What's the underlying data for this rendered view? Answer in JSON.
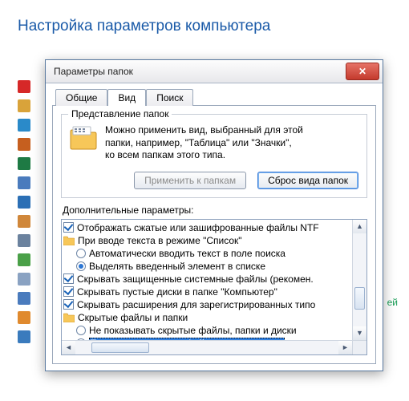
{
  "page": {
    "title": "Настройка параметров компьютера"
  },
  "side_text": "ей",
  "sidebar_icons": [
    {
      "name": "flash-icon",
      "bg": "#d62828"
    },
    {
      "name": "font-icon",
      "bg": "#d9a33a"
    },
    {
      "name": "apps-icon",
      "bg": "#2a8ac9"
    },
    {
      "name": "install-icon",
      "bg": "#c65f1f"
    },
    {
      "name": "monitor-icon",
      "bg": "#1e7a44"
    },
    {
      "name": "drive-icon",
      "bg": "#4a7bbd"
    },
    {
      "name": "lock-icon",
      "bg": "#2b6fb5"
    },
    {
      "name": "chart-icon",
      "bg": "#d0873a"
    },
    {
      "name": "device-icon",
      "bg": "#6b829e"
    },
    {
      "name": "audio-icon",
      "bg": "#4aa048"
    },
    {
      "name": "shield-icon",
      "bg": "#8aa2c2"
    },
    {
      "name": "clock-icon",
      "bg": "#4a7bbd"
    },
    {
      "name": "efax-icon",
      "bg": "#e08a2e"
    },
    {
      "name": "cpu-icon",
      "bg": "#3a7bbd"
    }
  ],
  "dialog": {
    "title": "Параметры папок",
    "close_glyph": "✕",
    "tabs": [
      {
        "id": "general",
        "label": "Общие"
      },
      {
        "id": "view",
        "label": "Вид"
      },
      {
        "id": "search",
        "label": "Поиск"
      }
    ],
    "active_tab": "view",
    "view_tab": {
      "group": {
        "legend": "Представление папок",
        "desc1": "Можно применить вид, выбранный для этой",
        "desc2": "папки, например, \"Таблица\" или \"Значки\",",
        "desc3": "ко всем папкам этого типа.",
        "apply_btn": "Применить к папкам",
        "reset_btn": "Сброс вида папок"
      },
      "adv_label": "Дополнительные параметры:",
      "tree": [
        {
          "type": "checkbox",
          "checked": true,
          "indent": 0,
          "label": "Отображать сжатые или зашифрованные файлы NTF"
        },
        {
          "type": "folder",
          "indent": 0,
          "label": "При вводе текста в режиме \"Список\""
        },
        {
          "type": "radio",
          "checked": false,
          "indent": 1,
          "label": "Автоматически вводить текст в поле поиска"
        },
        {
          "type": "radio",
          "checked": true,
          "indent": 1,
          "label": "Выделять введенный элемент в списке"
        },
        {
          "type": "checkbox",
          "checked": true,
          "indent": 0,
          "label": "Скрывать защищенные системные файлы (рекомен."
        },
        {
          "type": "checkbox",
          "checked": true,
          "indent": 0,
          "label": "Скрывать пустые диски в папке \"Компьютер\""
        },
        {
          "type": "checkbox",
          "checked": true,
          "indent": 0,
          "label": "Скрывать расширения для зарегистрированных типо"
        },
        {
          "type": "folder",
          "indent": 0,
          "label": "Скрытые файлы и папки"
        },
        {
          "type": "radio",
          "checked": false,
          "indent": 1,
          "label": "Не показывать скрытые файлы, папки и диски"
        },
        {
          "type": "radio",
          "checked": true,
          "indent": 1,
          "selected": true,
          "label": "Показывать скрытые файлы, папки и диски"
        }
      ]
    }
  }
}
